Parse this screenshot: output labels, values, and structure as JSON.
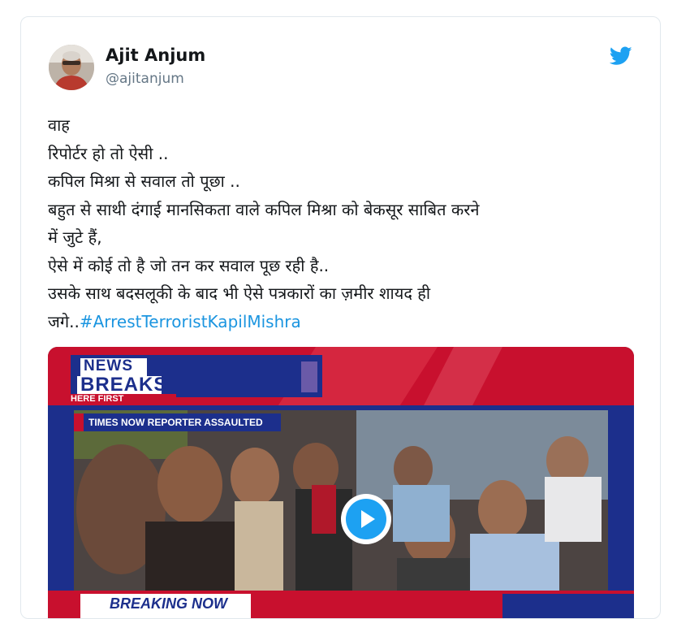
{
  "tweet": {
    "author_name": "Ajit Anjum",
    "author_handle": "@ajitanjum",
    "lines": [
      "वाह",
      "रिपोर्टर हो तो ऐसी ..",
      "कपिल मिश्रा से सवाल तो पूछा ..",
      "बहुत से साथी दंगाई मानसिकता वाले कपिल मिश्रा को बेकसूर साबित करने",
      "में जुटे हैं,",
      "ऐसे में कोई तो है जो तन कर सवाल पूछ रही है..",
      "उसके साथ बदसलूकी के बाद भी ऐसे पत्रकारों का ज़मीर शायद ही"
    ],
    "last_line_prefix": "जगे..",
    "hashtag": "#ArrestTerroristKapilMishra"
  },
  "video": {
    "logo_line1": "NEWS",
    "logo_line2": "BREAKS",
    "logo_line3": "HERE FIRST",
    "headline": "TIMES NOW REPORTER ASSAULTED",
    "ticker": "BREAKING NOW"
  },
  "colors": {
    "twitter_blue": "#1da1f2",
    "hashtag_blue": "#1b95e0",
    "channel_red": "#c8102e",
    "channel_blue": "#1c2f8c"
  }
}
